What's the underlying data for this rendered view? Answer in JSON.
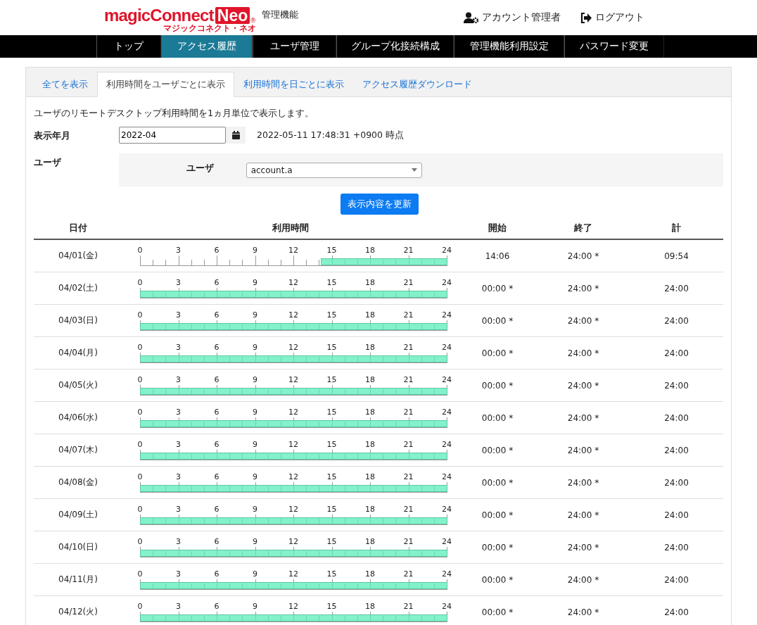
{
  "header": {
    "logo": {
      "main": "magicConnect",
      "badge": "Neo",
      "registered": "®",
      "reading": "マジックコネクト・ネオ"
    },
    "subtitle": "管理機能",
    "links": [
      {
        "kind": "account",
        "label": "アカウント管理者"
      },
      {
        "kind": "logout",
        "label": "ログアウト"
      }
    ]
  },
  "nav": [
    {
      "label": "トップ",
      "selected": false
    },
    {
      "label": "アクセス履歴",
      "selected": true
    },
    {
      "label": "ユーザ管理",
      "selected": false
    },
    {
      "label": "グループ化接続構成",
      "selected": false
    },
    {
      "label": "管理機能利用設定",
      "selected": false
    },
    {
      "label": "パスワード変更",
      "selected": false
    }
  ],
  "tabs": [
    {
      "label": "全てを表示",
      "selected": false
    },
    {
      "label": "利用時間をユーザごとに表示",
      "selected": true
    },
    {
      "label": "利用時間を日ごとに表示",
      "selected": false
    },
    {
      "label": "アクセス履歴ダウンロード",
      "selected": false
    }
  ],
  "description": "ユーザのリモートデスクトップ利用時間を1ヵ月単位で表示します。",
  "form": {
    "month_label": "表示年月",
    "month_value": "2022-04",
    "timestamp": "2022-05-11 17:48:31 +0900 時点",
    "user_label": "ユーザ",
    "user_field_label": "ユーザ",
    "user_value": "account.a",
    "update_button": "表示内容を更新"
  },
  "table": {
    "columns": [
      "日付",
      "利用時間",
      "開始",
      "終了",
      "計"
    ],
    "rows": [
      {
        "date": "04/01(金)",
        "ticks": [
          "0",
          "3",
          "6",
          "9",
          "12",
          "15",
          "18",
          "21",
          "24"
        ],
        "level": 0.4125,
        "start": "14:06",
        "end": "24:00 *",
        "total": "09:54"
      },
      {
        "date": "04/02(土)",
        "ticks": [
          "0",
          "3",
          "6",
          "9",
          "12",
          "15",
          "18",
          "21",
          "24"
        ],
        "level": 1,
        "start": "00:00 *",
        "end": "24:00 *",
        "total": "24:00"
      },
      {
        "date": "04/03(日)",
        "ticks": [
          "0",
          "3",
          "6",
          "9",
          "12",
          "15",
          "18",
          "21",
          "24"
        ],
        "level": 1,
        "start": "00:00 *",
        "end": "24:00 *",
        "total": "24:00"
      },
      {
        "date": "04/04(月)",
        "ticks": [
          "0",
          "3",
          "6",
          "9",
          "12",
          "15",
          "18",
          "21",
          "24"
        ],
        "level": 1,
        "start": "00:00 *",
        "end": "24:00 *",
        "total": "24:00"
      },
      {
        "date": "04/05(火)",
        "ticks": [
          "0",
          "3",
          "6",
          "9",
          "12",
          "15",
          "18",
          "21",
          "24"
        ],
        "level": 1,
        "start": "00:00 *",
        "end": "24:00 *",
        "total": "24:00"
      },
      {
        "date": "04/06(水)",
        "ticks": [
          "0",
          "3",
          "6",
          "9",
          "12",
          "15",
          "18",
          "21",
          "24"
        ],
        "level": 1,
        "start": "00:00 *",
        "end": "24:00 *",
        "total": "24:00"
      },
      {
        "date": "04/07(木)",
        "ticks": [
          "0",
          "3",
          "6",
          "9",
          "12",
          "15",
          "18",
          "21",
          "24"
        ],
        "level": 1,
        "start": "00:00 *",
        "end": "24:00 *",
        "total": "24:00"
      },
      {
        "date": "04/08(金)",
        "ticks": [
          "0",
          "3",
          "6",
          "9",
          "12",
          "15",
          "18",
          "21",
          "24"
        ],
        "level": 1,
        "start": "00:00 *",
        "end": "24:00 *",
        "total": "24:00"
      },
      {
        "date": "04/09(土)",
        "ticks": [
          "0",
          "3",
          "6",
          "9",
          "12",
          "15",
          "18",
          "21",
          "24"
        ],
        "level": 1,
        "start": "00:00 *",
        "end": "24:00 *",
        "total": "24:00"
      },
      {
        "date": "04/10(日)",
        "ticks": [
          "0",
          "3",
          "6",
          "9",
          "12",
          "15",
          "18",
          "21",
          "24"
        ],
        "level": 1,
        "start": "00:00 *",
        "end": "24:00 *",
        "total": "24:00"
      },
      {
        "date": "04/11(月)",
        "ticks": [
          "0",
          "3",
          "6",
          "9",
          "12",
          "15",
          "18",
          "21",
          "24"
        ],
        "level": 1,
        "start": "00:00 *",
        "end": "24:00 *",
        "total": "24:00"
      },
      {
        "date": "04/12(火)",
        "ticks": [
          "0",
          "3",
          "6",
          "9",
          "12",
          "15",
          "18",
          "21",
          "24"
        ],
        "level": 1,
        "start": "00:00 *",
        "end": "24:00 *",
        "total": "24:00"
      }
    ]
  }
}
